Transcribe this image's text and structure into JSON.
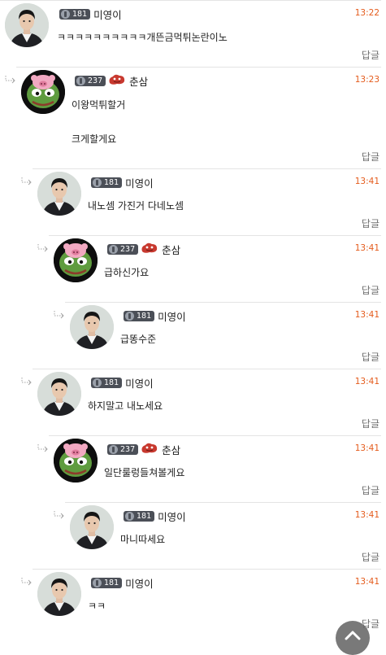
{
  "reply_label": "답글",
  "comments": [
    {
      "level": "181",
      "nick": "미영이",
      "time": "13:22",
      "lines": [
        "ㅋㅋㅋㅋㅋㅋㅋㅋㅋㅋ개뜬금먹튀논란이노"
      ],
      "avatar": "person-avatar",
      "badge": "none"
    },
    {
      "level": "237",
      "nick": "춘삼",
      "time": "13:23",
      "lines": [
        "이왕먹튀할거",
        "크게할게요"
      ],
      "avatar": "pepe-avatar",
      "badge": "red-blob-icon"
    },
    {
      "level": "181",
      "nick": "미영이",
      "time": "13:41",
      "lines": [
        "내노셈 가진거 다네노셈"
      ],
      "avatar": "person-avatar",
      "badge": "none"
    },
    {
      "level": "237",
      "nick": "춘삼",
      "time": "13:41",
      "lines": [
        "급하신가요"
      ],
      "avatar": "pepe-avatar",
      "badge": "red-blob-icon"
    },
    {
      "level": "181",
      "nick": "미영이",
      "time": "13:41",
      "lines": [
        "급똥수준"
      ],
      "avatar": "person-avatar",
      "badge": "none"
    },
    {
      "level": "181",
      "nick": "미영이",
      "time": "13:41",
      "lines": [
        "하지말고 내노세요"
      ],
      "avatar": "person-avatar",
      "badge": "none"
    },
    {
      "level": "237",
      "nick": "춘삼",
      "time": "13:41",
      "lines": [
        "일단룰렁들쳐볼게요"
      ],
      "avatar": "pepe-avatar",
      "badge": "red-blob-icon"
    },
    {
      "level": "181",
      "nick": "미영이",
      "time": "13:41",
      "lines": [
        "마니따세요"
      ],
      "avatar": "person-avatar",
      "badge": "none"
    },
    {
      "level": "181",
      "nick": "미영이",
      "time": "13:41",
      "lines": [
        "ㅋㅋ"
      ],
      "avatar": "person-avatar",
      "badge": "none"
    }
  ]
}
